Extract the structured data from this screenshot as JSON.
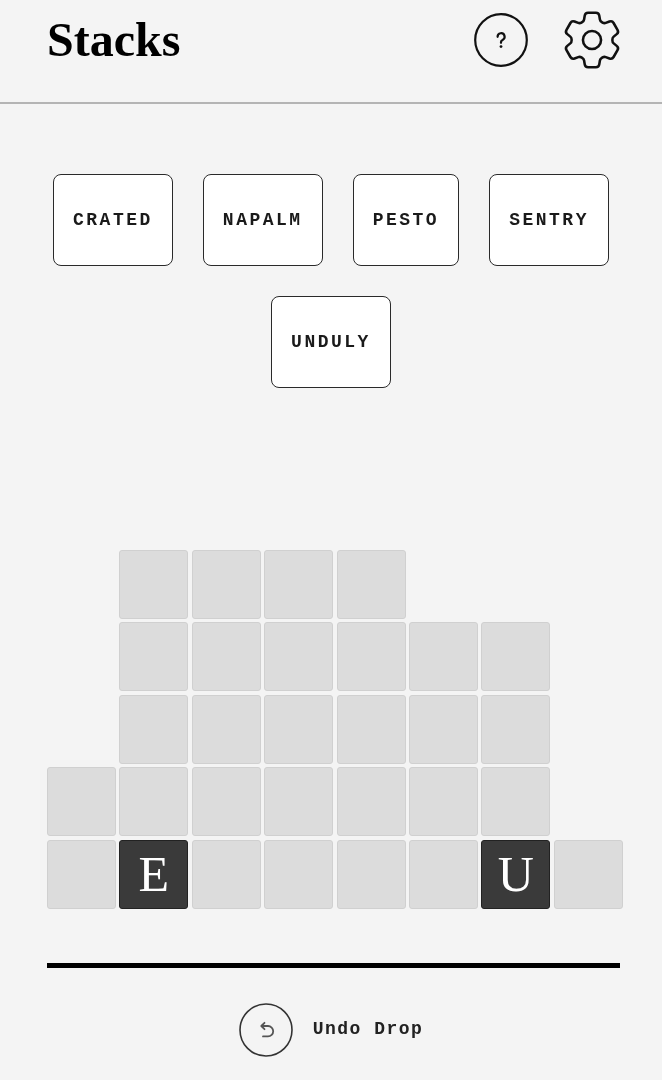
{
  "header": {
    "title": "Stacks"
  },
  "words": [
    "CRATED",
    "NAPALM",
    "PESTO",
    "SENTRY",
    "UNDULY"
  ],
  "board": {
    "columns": [
      {
        "cells": [
          {
            "filled": false
          },
          {
            "filled": false
          }
        ]
      },
      {
        "cells": [
          {
            "filled": false
          },
          {
            "filled": false
          },
          {
            "filled": false
          },
          {
            "filled": false
          },
          {
            "filled": true,
            "letter": "E"
          }
        ]
      },
      {
        "cells": [
          {
            "filled": false
          },
          {
            "filled": false
          },
          {
            "filled": false
          },
          {
            "filled": false
          },
          {
            "filled": false
          }
        ]
      },
      {
        "cells": [
          {
            "filled": false
          },
          {
            "filled": false
          },
          {
            "filled": false
          },
          {
            "filled": false
          },
          {
            "filled": false
          }
        ]
      },
      {
        "cells": [
          {
            "filled": false
          },
          {
            "filled": false
          },
          {
            "filled": false
          },
          {
            "filled": false
          },
          {
            "filled": false
          }
        ]
      },
      {
        "cells": [
          {
            "filled": false
          },
          {
            "filled": false
          },
          {
            "filled": false
          },
          {
            "filled": false
          }
        ]
      },
      {
        "cells": [
          {
            "filled": false
          },
          {
            "filled": false
          },
          {
            "filled": false
          },
          {
            "filled": true,
            "letter": "U"
          }
        ]
      },
      {
        "cells": [
          {
            "filled": false
          }
        ]
      }
    ]
  },
  "undo_button": {
    "label": "Undo Drop"
  }
}
